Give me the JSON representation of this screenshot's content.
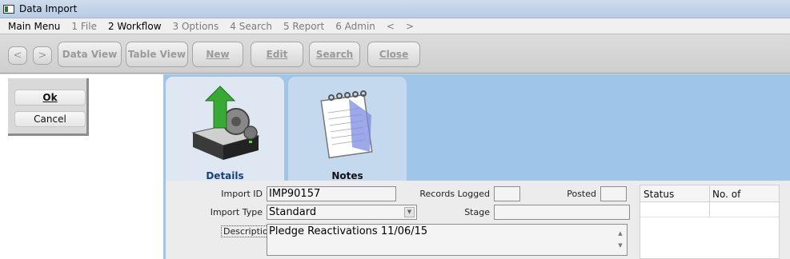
{
  "window": {
    "title": "Data Import"
  },
  "menu": [
    "Main Menu",
    "1 File",
    "2 Workflow",
    "3 Options",
    "4 Search",
    "5 Report",
    "6 Admin",
    "<",
    ">"
  ],
  "toolbar": {
    "back": "<",
    "forward": ">",
    "data_view": "Data View",
    "table_view": "Table View",
    "new": "New",
    "edit": "Edit",
    "search": "Search",
    "close": "Close"
  },
  "dialog": {
    "ok": "Ok",
    "cancel": "Cancel"
  },
  "tabs": {
    "details": "Details",
    "notes": "Notes"
  },
  "form": {
    "import_id_label": "Import ID",
    "import_id": "IMP90157",
    "import_type_label": "Import Type",
    "import_type": "Standard",
    "description_label": "Description",
    "description": "Pledge Reactivations 11/06/15",
    "records_logged_label": "Records Logged",
    "records_logged": "",
    "posted_label": "Posted",
    "posted": "",
    "stage_label": "Stage",
    "stage": ""
  },
  "status_grid": {
    "col1": "Status",
    "col2": "No. of"
  }
}
